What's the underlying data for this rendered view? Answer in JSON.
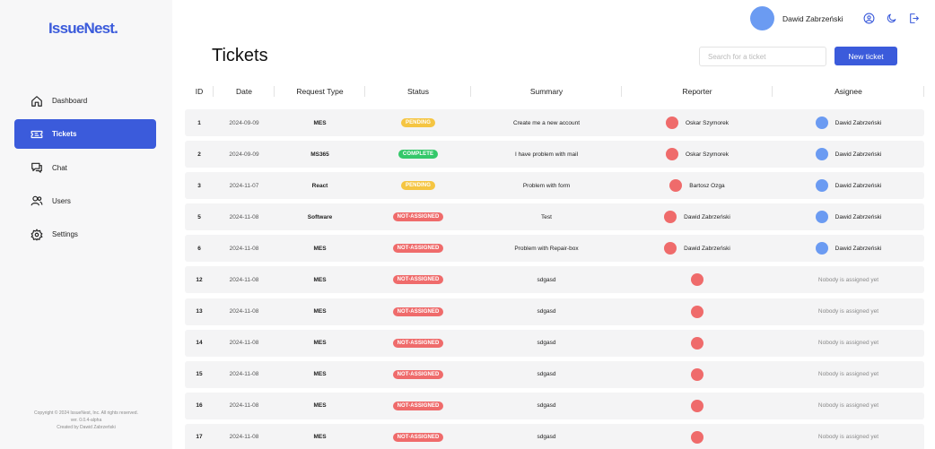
{
  "brand": {
    "logo": "IssueNest."
  },
  "sidebar": {
    "items": [
      {
        "label": "Dashboard",
        "icon": "home-icon",
        "active": false
      },
      {
        "label": "Tickets",
        "icon": "ticket-icon",
        "active": true
      },
      {
        "label": "Chat",
        "icon": "chat-icon",
        "active": false
      },
      {
        "label": "Users",
        "icon": "users-icon",
        "active": false
      },
      {
        "label": "Settings",
        "icon": "gear-icon",
        "active": false
      }
    ],
    "footer": {
      "line1": "Copyright © 2024 IssueNest, Inc. All rights reserved.",
      "line2": "ver. 0.0.4-alpha",
      "line3": "Created by Dawid Zabrzeński"
    }
  },
  "header": {
    "user_name": "Dawid Zabrzeński",
    "icons": [
      "user-circle-icon",
      "moon-icon",
      "logout-icon"
    ]
  },
  "main": {
    "title": "Tickets",
    "search_placeholder": "Search for a ticket",
    "new_ticket_label": "New ticket"
  },
  "colors": {
    "accent": "#3b5bdb",
    "pending": "#f5c542",
    "complete": "#34c86a",
    "not_assigned": "#ef6b6b",
    "reporter_avatar": "#ef6b6b",
    "assignee_avatar": "#6b9bf2"
  },
  "table": {
    "columns": [
      "ID",
      "Date",
      "Request Type",
      "Status",
      "Summary",
      "Reporter",
      "Asignee"
    ],
    "rows": [
      {
        "id": "1",
        "date": "2024-09-09",
        "type": "MES",
        "status": "PENDING",
        "summary": "Create me a new account",
        "reporter": "Oskar Szymorek",
        "assignee": "Dawid Zabrzeński"
      },
      {
        "id": "2",
        "date": "2024-09-09",
        "type": "MS365",
        "status": "COMPLETE",
        "summary": "I have problem with mail",
        "reporter": "Oskar Szymorek",
        "assignee": "Dawid Zabrzeński"
      },
      {
        "id": "3",
        "date": "2024-11-07",
        "type": "React",
        "status": "PENDING",
        "summary": "Problem with form",
        "reporter": "Bartosz Ozga",
        "assignee": "Dawid Zabrzeński"
      },
      {
        "id": "5",
        "date": "2024-11-08",
        "type": "Software",
        "status": "NOT-ASSIGNED",
        "summary": "Test",
        "reporter": "Dawid Zabrzeński",
        "assignee": "Dawid Zabrzeński"
      },
      {
        "id": "6",
        "date": "2024-11-08",
        "type": "MES",
        "status": "NOT-ASSIGNED",
        "summary": "Problem with Repair-box",
        "reporter": "Dawid Zabrzeński",
        "assignee": "Dawid Zabrzeński"
      },
      {
        "id": "12",
        "date": "2024-11-08",
        "type": "MES",
        "status": "NOT-ASSIGNED",
        "summary": "sdgasd",
        "reporter": "",
        "assignee": ""
      },
      {
        "id": "13",
        "date": "2024-11-08",
        "type": "MES",
        "status": "NOT-ASSIGNED",
        "summary": "sdgasd",
        "reporter": "",
        "assignee": ""
      },
      {
        "id": "14",
        "date": "2024-11-08",
        "type": "MES",
        "status": "NOT-ASSIGNED",
        "summary": "sdgasd",
        "reporter": "",
        "assignee": ""
      },
      {
        "id": "15",
        "date": "2024-11-08",
        "type": "MES",
        "status": "NOT-ASSIGNED",
        "summary": "sdgasd",
        "reporter": "",
        "assignee": ""
      },
      {
        "id": "16",
        "date": "2024-11-08",
        "type": "MES",
        "status": "NOT-ASSIGNED",
        "summary": "sdgasd",
        "reporter": "",
        "assignee": ""
      },
      {
        "id": "17",
        "date": "2024-11-08",
        "type": "MES",
        "status": "NOT-ASSIGNED",
        "summary": "sdgasd",
        "reporter": "",
        "assignee": ""
      }
    ],
    "nobody_text": "Nobody is assigned yet"
  }
}
